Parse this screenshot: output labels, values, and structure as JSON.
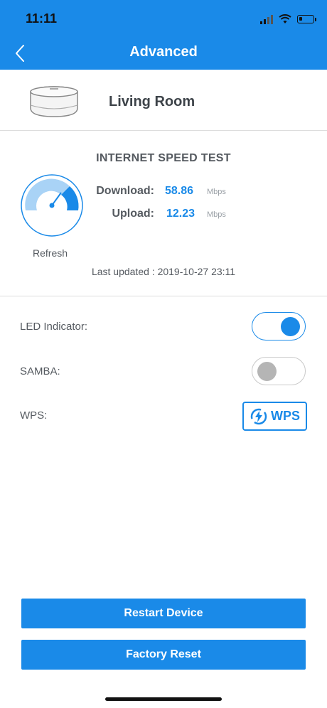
{
  "status_bar": {
    "time": "11:11"
  },
  "header": {
    "title": "Advanced"
  },
  "device": {
    "name": "Living Room"
  },
  "speed_test": {
    "heading": "INTERNET SPEED TEST",
    "download_label": "Download:",
    "download_value": "58.86",
    "download_unit": "Mbps",
    "upload_label": "Upload:",
    "upload_value": "12.23",
    "upload_unit": "Mbps",
    "refresh_label": "Refresh",
    "last_updated": "Last updated : 2019-10-27 23:11"
  },
  "settings": {
    "led": {
      "label": "LED Indicator:",
      "enabled": true
    },
    "samba": {
      "label": "SAMBA:",
      "enabled": false
    },
    "wps": {
      "label": "WPS:",
      "button_text": "WPS"
    }
  },
  "actions": {
    "restart": "Restart Device",
    "factory_reset": "Factory Reset"
  },
  "colors": {
    "accent": "#1a8ae8",
    "text": "#555a60"
  }
}
